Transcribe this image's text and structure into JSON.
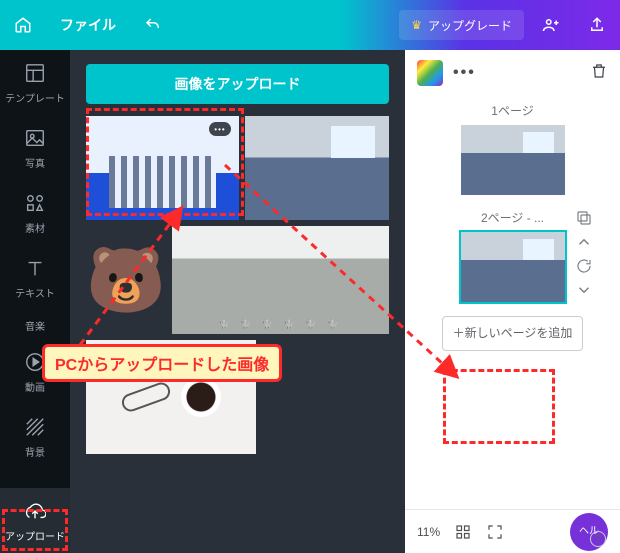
{
  "header": {
    "file_label": "ファイル",
    "upgrade_label": "アップグレード"
  },
  "rail": {
    "template": "テンプレート",
    "photo": "写真",
    "element": "素材",
    "text": "テキスト",
    "audio": "音楽",
    "video": "動画",
    "background": "背景",
    "upload": "アップロード"
  },
  "panel": {
    "upload_button": "画像をアップロード"
  },
  "annotation": {
    "label": "PCからアップロードした画像"
  },
  "pages": {
    "page1_label": "1ページ",
    "page2_label": "2ページ - ...",
    "add_page_label": "＋新しいページを追加"
  },
  "zoom": {
    "percent": "11%",
    "help": "ヘル"
  }
}
